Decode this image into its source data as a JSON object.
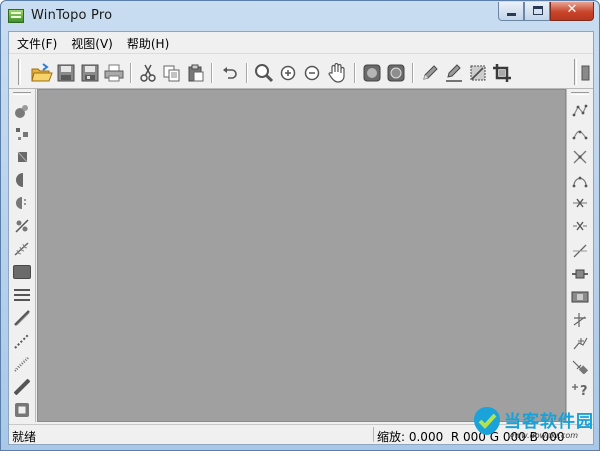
{
  "window": {
    "title": "WinTopo Pro",
    "caption_buttons": [
      "minimize",
      "maximize",
      "close"
    ]
  },
  "menu": {
    "items": [
      "文件(F)",
      "视图(V)",
      "帮助(H)"
    ]
  },
  "toolbar": {
    "icons": [
      "open-folder-icon",
      "save-icon",
      "save-as-icon",
      "print-icon",
      "cut-icon",
      "copy-icon",
      "paste-icon",
      "undo-icon",
      "zoom-icon",
      "zoom-in-icon",
      "zoom-out-icon",
      "pan-hand-icon",
      "view-raster-icon",
      "view-vector-icon",
      "pencil-icon",
      "edit-pencil-icon",
      "select-area-icon",
      "crop-icon",
      "toolbar-overflow-icon"
    ]
  },
  "left_toolbar": {
    "icons": [
      "thin-icon",
      "despeckle-icon",
      "threshold-icon",
      "fill-holes-icon",
      "smooth-icon",
      "remove-isolated-icon",
      "stentiford-icon",
      "solid-fill-icon",
      "line-thin-icon",
      "diagonal-line-icon",
      "dotted-line-icon",
      "dashed-line-icon",
      "thick-line-icon",
      "frame-icon"
    ]
  },
  "right_toolbar": {
    "icons": [
      "polyline-icon",
      "smooth-polyline-icon",
      "join-icon",
      "curve-icon",
      "remove-vertex-icon",
      "delete-node-icon",
      "split-icon",
      "node-icon",
      "crossing-icon",
      "angle-icon",
      "tag-icon",
      "help-query-icon"
    ]
  },
  "canvas": {
    "background": "#a0a0a0"
  },
  "status": {
    "ready": "就绪",
    "zoom_label": "缩放: 0.000",
    "rgb_text": "R 000 G 000 B 000"
  },
  "watermark": {
    "name": "当客软件园",
    "url": "www.downkr.com"
  },
  "colors": {
    "title_bar": "#b9d1ea",
    "close_button": "#c8452b",
    "canvas": "#a0a0a0",
    "watermark_blue": "#17a2d9"
  }
}
